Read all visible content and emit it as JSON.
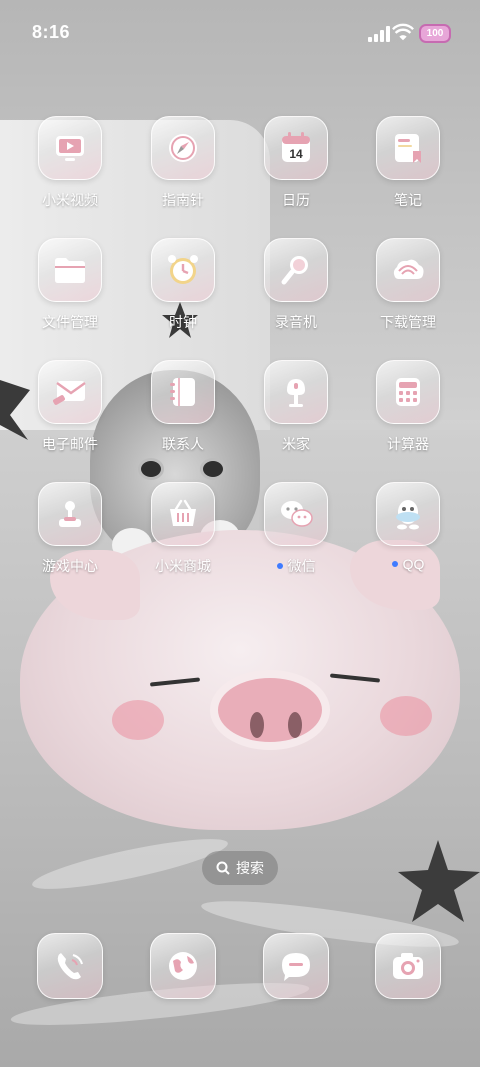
{
  "status_bar": {
    "time": "8:16",
    "battery": "100",
    "icons": [
      "signal-icon",
      "wifi-icon",
      "battery-icon"
    ]
  },
  "apps": [
    {
      "label": "小米视频",
      "icon": "video-icon"
    },
    {
      "label": "指南针",
      "icon": "compass-icon"
    },
    {
      "label": "日历",
      "icon": "calendar-icon",
      "badge": "14"
    },
    {
      "label": "笔记",
      "icon": "notes-icon"
    },
    {
      "label": "文件管理",
      "icon": "folder-icon"
    },
    {
      "label": "时钟",
      "icon": "clock-icon"
    },
    {
      "label": "录音机",
      "icon": "recorder-icon"
    },
    {
      "label": "下载管理",
      "icon": "download-icon"
    },
    {
      "label": "电子邮件",
      "icon": "mail-icon"
    },
    {
      "label": "联系人",
      "icon": "contacts-icon"
    },
    {
      "label": "米家",
      "icon": "mijia-icon"
    },
    {
      "label": "计算器",
      "icon": "calculator-icon"
    },
    {
      "label": "游戏中心",
      "icon": "joystick-icon"
    },
    {
      "label": "小米商城",
      "icon": "shop-basket-icon"
    },
    {
      "label": "微信",
      "icon": "wechat-icon",
      "new_dot": true
    },
    {
      "label": "QQ",
      "icon": "qq-icon",
      "new_dot": true
    }
  ],
  "search": {
    "label": "搜索",
    "icon": "search-icon"
  },
  "dock": [
    {
      "icon": "phone-icon"
    },
    {
      "icon": "browser-icon"
    },
    {
      "icon": "messages-icon"
    },
    {
      "icon": "camera-icon"
    }
  ],
  "colors": {
    "notification_dot": "#3f7bff",
    "battery": "#e7a6d8",
    "icon_accent": "#e6a3b2"
  }
}
